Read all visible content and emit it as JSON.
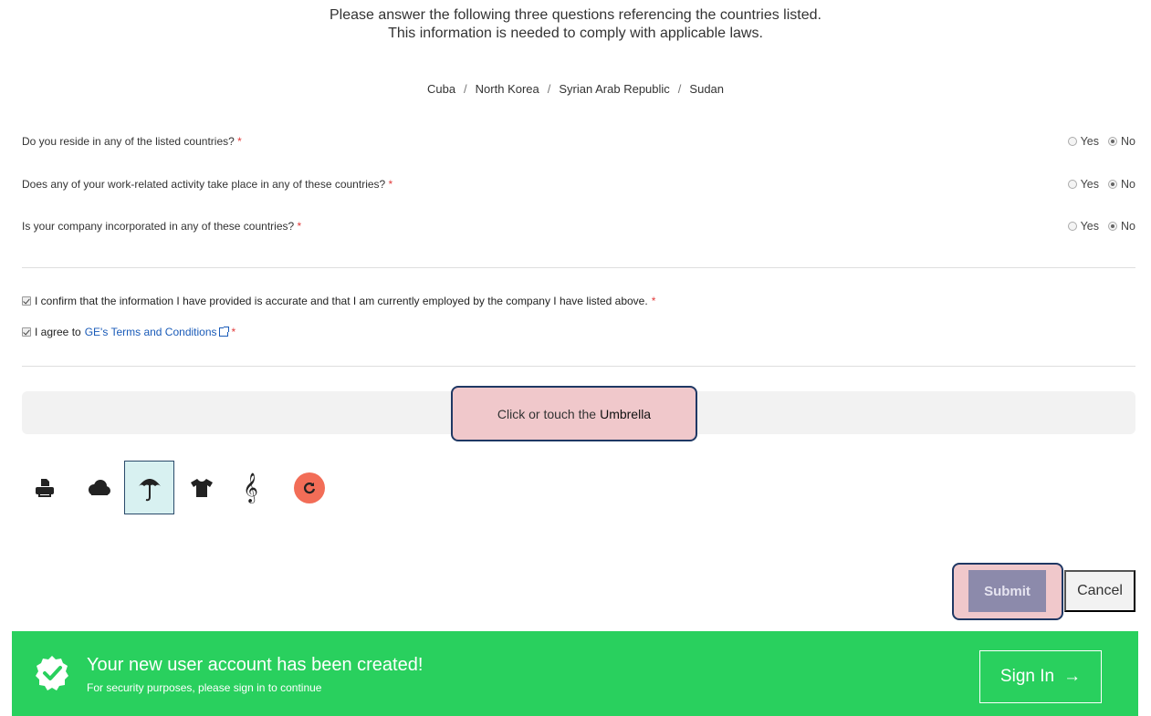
{
  "intro": {
    "line1": "Please answer the following three questions referencing the countries listed.",
    "line2": "This information is needed to comply with applicable laws."
  },
  "countries": [
    "Cuba",
    "North Korea",
    "Syrian Arab Republic",
    "Sudan"
  ],
  "country_separator": "/",
  "questions": [
    {
      "text": "Do you reside in any of the listed countries?",
      "required": "*",
      "yes": "Yes",
      "no": "No",
      "selected": "No"
    },
    {
      "text": "Does any of your work-related activity take place in any of these countries?",
      "required": "*",
      "yes": "Yes",
      "no": "No",
      "selected": "No"
    },
    {
      "text": "Is your company incorporated in any of these countries?",
      "required": "*",
      "yes": "Yes",
      "no": "No",
      "selected": "No"
    }
  ],
  "confirm": {
    "text": "I confirm that the information I have provided is accurate and that I am currently employed by the company I have listed above.",
    "required": "*",
    "checked": true
  },
  "terms": {
    "prefix": "I agree to",
    "link": "GE's Terms and Conditions",
    "required": "*",
    "checked": true
  },
  "captcha": {
    "prompt_prefix": "Click or touch the",
    "target": "Umbrella",
    "icons": [
      "printer-icon",
      "cloud-icon",
      "umbrella-icon",
      "tshirt-icon",
      "treble-clef-icon"
    ],
    "selected": "umbrella-icon",
    "reload_glyph": "C"
  },
  "actions": {
    "submit": "Submit",
    "cancel": "Cancel"
  },
  "banner": {
    "title": "Your new user account has been created!",
    "subtitle": "For security purposes, please sign in to continue",
    "signin": "Sign In",
    "signin_arrow": "→",
    "color": "#29d05e"
  },
  "colors": {
    "required": "#e23b3b",
    "link": "#1a5bb8",
    "highlight": "#f0c8cb",
    "submit": "#8c8aab",
    "reload": "#f26d57"
  }
}
